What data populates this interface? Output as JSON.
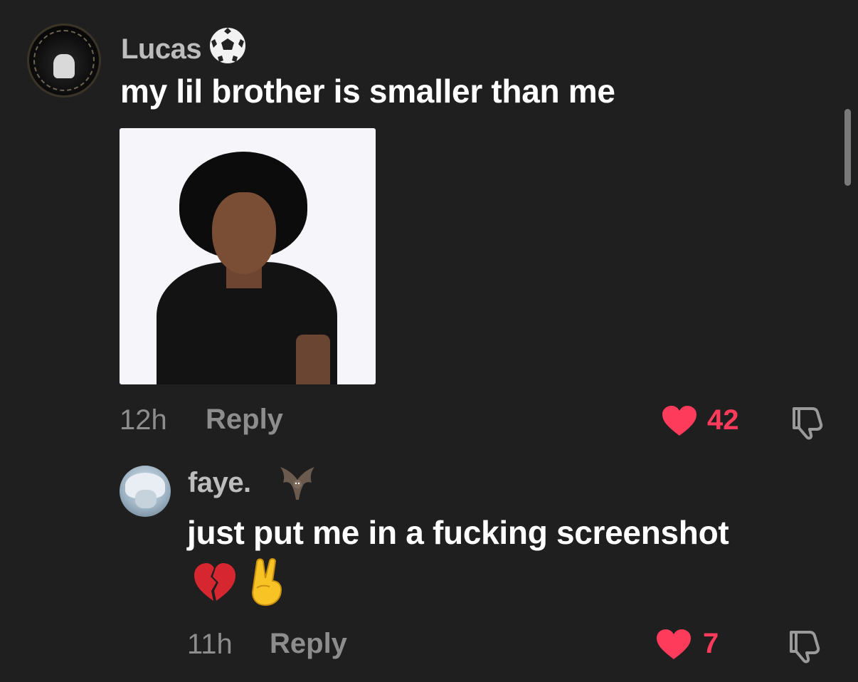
{
  "comments": [
    {
      "username": "Lucas",
      "username_emoji": "⚽",
      "text": "my lil brother is smaller than me",
      "time": "12h",
      "reply_label": "Reply",
      "likes": "42"
    },
    {
      "username": "faye.",
      "username_emoji": "bat",
      "text": "just put me in a fucking screenshot",
      "emoji_line": [
        "💔",
        "✌"
      ],
      "time": "11h",
      "reply_label": "Reply",
      "likes": "7"
    }
  ],
  "colors": {
    "background": "#1f1f1f",
    "like_heart": "#ff3b5c",
    "muted_text": "#8d8d8d",
    "username": "#bdbdbd"
  },
  "icons": [
    "heart-icon",
    "dislike-icon",
    "soccer-ball-emoji",
    "bat-emoji",
    "broken-heart-emoji",
    "peace-hand-emoji"
  ]
}
